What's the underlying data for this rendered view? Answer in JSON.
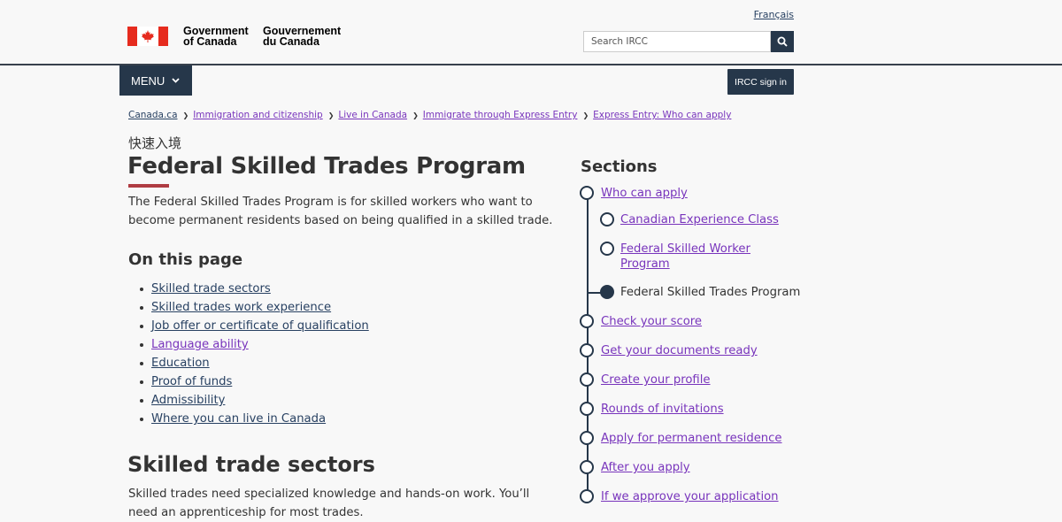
{
  "header": {
    "lang_toggle": "Français",
    "wordmark_en_line1": "Government",
    "wordmark_en_line2": "of Canada",
    "wordmark_fr_line1": "Gouvernement",
    "wordmark_fr_line2": "du Canada",
    "search_placeholder": "Search IRCC"
  },
  "menu": {
    "label": "MENU",
    "signin_label": "IRCC sign in"
  },
  "breadcrumb": [
    "Canada.ca",
    "Immigration and citizenship",
    "Live in Canada",
    "Immigrate through Express Entry",
    "Express Entry: Who can apply"
  ],
  "main": {
    "language_label": "快速入境",
    "title": "Federal Skilled Trades Program",
    "intro": "The Federal Skilled Trades Program is for skilled workers who want to become permanent residents based on being qualified in a skilled trade.",
    "on_this_page_heading": "On this page",
    "toc": [
      "Skilled trade sectors",
      "Skilled trades work experience",
      "Job offer or certificate of qualification",
      "Language ability",
      "Education",
      "Proof of funds",
      "Admissibility",
      "Where you can live in Canada"
    ],
    "section_heading": "Skilled trade sectors",
    "section_body": "Skilled trades need specialized knowledge and hands-on work. You’ll need an apprenticeship for most trades."
  },
  "sections": {
    "heading": "Sections",
    "items": [
      "Who can apply",
      "Canadian Experience Class",
      "Federal Skilled Worker Program",
      "Federal Skilled Trades Program",
      "Check your score",
      "Get your documents ready",
      "Create your profile",
      "Rounds of invitations",
      "Apply for permanent residence",
      "After you apply",
      "If we approve your application"
    ]
  },
  "colors": {
    "navy": "#26374a",
    "link": "#284162",
    "visited_link": "#7834bc",
    "accent_red": "#af3c43",
    "flag_red": "#e62b1e"
  }
}
